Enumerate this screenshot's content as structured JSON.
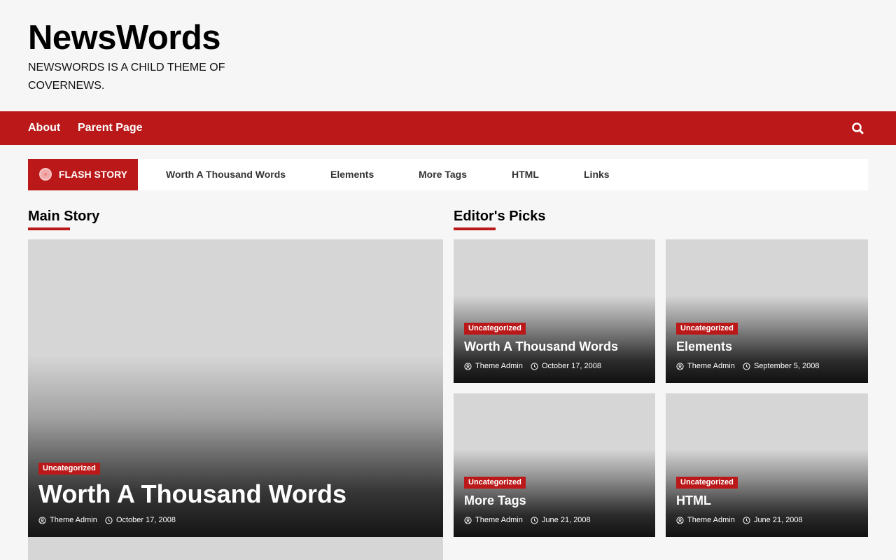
{
  "site": {
    "title": "NewsWords",
    "tagline": "NEWSWORDS IS A CHILD THEME OF COVERNEWS."
  },
  "nav": {
    "items": [
      "About",
      "Parent Page"
    ],
    "search_icon": "search-icon"
  },
  "flash": {
    "label": "FLASH STORY",
    "links": [
      "Worth A Thousand Words",
      "Elements",
      "More Tags",
      "HTML",
      "Links"
    ]
  },
  "main_story": {
    "heading": "Main Story",
    "category": "Uncategorized",
    "title": "Worth A Thousand Words",
    "author": "Theme Admin",
    "date": "October 17, 2008"
  },
  "editors_picks": {
    "heading": "Editor's Picks",
    "posts": [
      {
        "category": "Uncategorized",
        "title": "Worth A Thousand Words",
        "author": "Theme Admin",
        "date": "October 17, 2008"
      },
      {
        "category": "Uncategorized",
        "title": "Elements",
        "author": "Theme Admin",
        "date": "September 5, 2008"
      },
      {
        "category": "Uncategorized",
        "title": "More Tags",
        "author": "Theme Admin",
        "date": "June 21, 2008"
      },
      {
        "category": "Uncategorized",
        "title": "HTML",
        "author": "Theme Admin",
        "date": "June 21, 2008"
      }
    ]
  },
  "colors": {
    "accent": "#bb1919",
    "background": "#f6f6f6",
    "placeholder": "#d6d6d6"
  }
}
